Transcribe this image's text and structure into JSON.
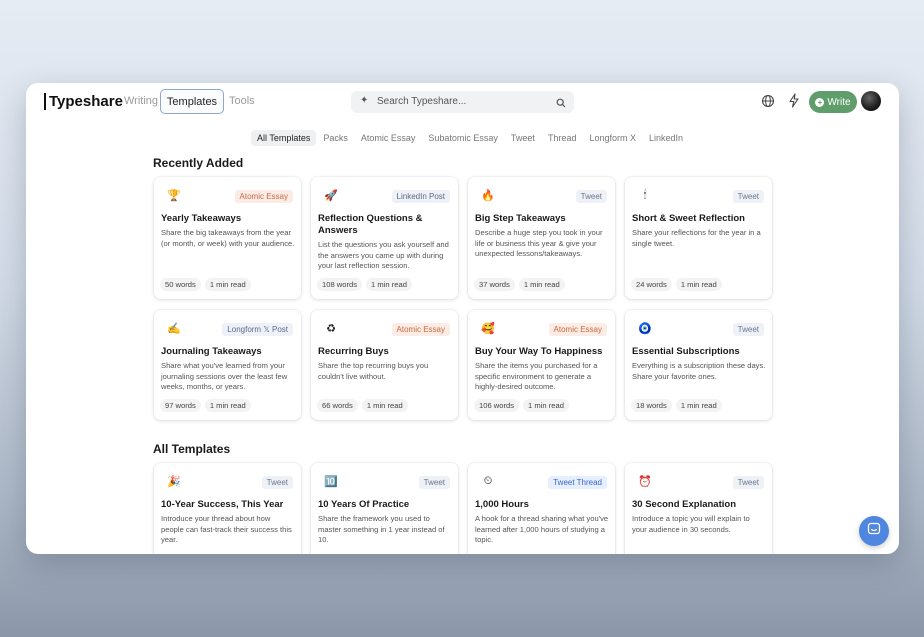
{
  "app": {
    "logo": "Typeshare",
    "nav": {
      "writing": "Writing",
      "templates": "Templates",
      "tools": "Tools"
    },
    "search_placeholder": "Search Typeshare...",
    "write_label": "Write",
    "accent": "#5f9e6a"
  },
  "filters": [
    "All Templates",
    "Packs",
    "Atomic Essay",
    "Subatomic Essay",
    "Tweet",
    "Thread",
    "Longform X",
    "LinkedIn"
  ],
  "sections": {
    "recent": "Recently Added",
    "all": "All Templates"
  },
  "recent_cards": [
    {
      "icon": "🏆",
      "icon_name": "trophy-icon",
      "badge": "Atomic Essay",
      "badge_type": "atomic",
      "title": "Yearly Takeaways",
      "desc": "Share the big takeaways from the year (or month, or week) with your audience.",
      "words": "50 words",
      "read": "1 min read"
    },
    {
      "icon": "🚀",
      "icon_name": "rocket-icon",
      "badge": "LinkedIn Post",
      "badge_type": "linkedin",
      "title": "Reflection Questions & Answers",
      "desc": "List the questions you ask yourself and the answers you came up with during your last reflection session.",
      "words": "108 words",
      "read": "1 min read"
    },
    {
      "icon": "🔥",
      "icon_name": "fire-icon",
      "badge": "Tweet",
      "badge_type": "tweet",
      "title": "Big Step Takeaways",
      "desc": "Describe a huge step you took in your life or business this year & give your unexpected lessons/takeaways.",
      "words": "37 words",
      "read": "1 min read"
    },
    {
      "icon": "🕯",
      "icon_name": "candle-icon",
      "badge": "Tweet",
      "badge_type": "tweet",
      "title": "Short & Sweet Reflection",
      "desc": "Share your reflections for the year in a single tweet.",
      "words": "24 words",
      "read": "1 min read"
    },
    {
      "icon": "✍",
      "icon_name": "writing-hand-icon",
      "badge": "Longform 𝕏 Post",
      "badge_type": "longform",
      "title": "Journaling Takeaways",
      "desc": "Share what you've learned from your journaling sessions over the least few weeks, months, or years.",
      "words": "97 words",
      "read": "1 min read"
    },
    {
      "icon": "♻",
      "icon_name": "recycle-icon",
      "badge": "Atomic Essay",
      "badge_type": "atomic",
      "title": "Recurring Buys",
      "desc": "Share the top recurring buys you couldn't live without.",
      "words": "66 words",
      "read": "1 min read"
    },
    {
      "icon": "🥰",
      "icon_name": "smiling-hearts-icon",
      "badge": "Atomic Essay",
      "badge_type": "atomic",
      "title": "Buy Your Way To Happiness",
      "desc": "Share the items you purchased for a specific environment to generate a highly-desired outcome.",
      "words": "106 words",
      "read": "1 min read"
    },
    {
      "icon": "🧿",
      "icon_name": "nazar-icon",
      "badge": "Tweet",
      "badge_type": "tweet",
      "title": "Essential Subscriptions",
      "desc": "Everything is a subscription these days. Share your favorite ones.",
      "words": "18 words",
      "read": "1 min read"
    }
  ],
  "all_cards": [
    {
      "icon": "🎉",
      "icon_name": "party-popper-icon",
      "badge": "Tweet",
      "badge_type": "tweet",
      "title": "10-Year Success, This Year",
      "desc": "Introduce your thread about how people can fast-track their success this year."
    },
    {
      "icon": "🔟",
      "icon_name": "keycap-ten-icon",
      "badge": "Tweet",
      "badge_type": "tweet",
      "title": "10 Years Of Practice",
      "desc": "Share the framework you used to master something in 1 year instead of 10."
    },
    {
      "icon": "⏲",
      "icon_name": "timer-icon",
      "badge": "Tweet Thread",
      "badge_type": "thread",
      "title": "1,000 Hours",
      "desc": "A hook for a thread sharing what you've learned after 1,000 hours of studying a topic."
    },
    {
      "icon": "⏰",
      "icon_name": "alarm-clock-icon",
      "badge": "Tweet",
      "badge_type": "tweet",
      "title": "30 Second Explanation",
      "desc": "Introduce a topic you will explain to your audience in 30 seconds."
    }
  ]
}
